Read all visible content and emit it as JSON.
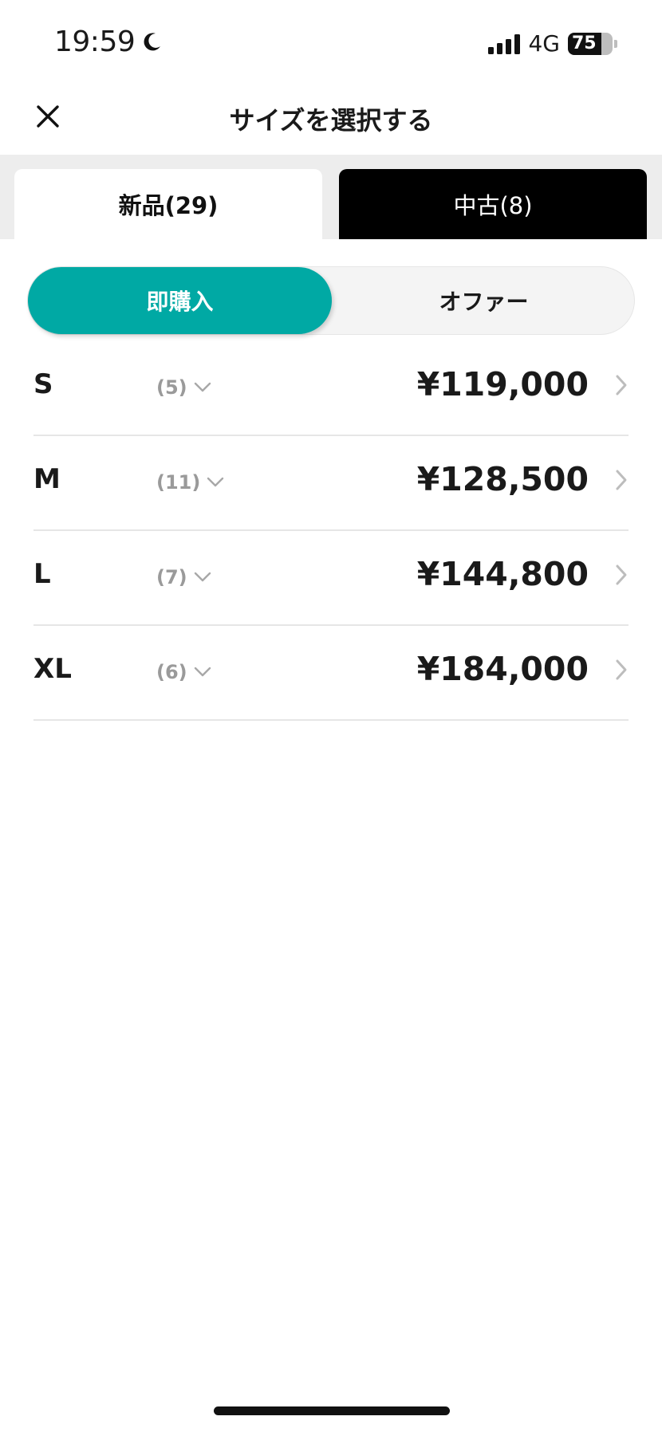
{
  "status_bar": {
    "time": "19:59",
    "network": "4G",
    "battery": "75",
    "battery_level_percent": 75
  },
  "header": {
    "title": "サイズを選択する",
    "close_icon": "close-icon"
  },
  "tabs": [
    {
      "label": "新品(29)",
      "selected": true
    },
    {
      "label": "中古(8)",
      "selected": false
    }
  ],
  "segment": {
    "instant_label": "即購入",
    "offer_label": "オファー",
    "selected": "instant"
  },
  "sizes": [
    {
      "size": "S",
      "count": "(5)",
      "price": "¥119,000"
    },
    {
      "size": "M",
      "count": "(11)",
      "price": "¥128,500"
    },
    {
      "size": "L",
      "count": "(7)",
      "price": "¥144,800"
    },
    {
      "size": "XL",
      "count": "(6)",
      "price": "¥184,000"
    }
  ],
  "colors": {
    "accent": "#00a9a4",
    "tab_inactive_bg": "#000000",
    "tab_strip_bg": "#ededed",
    "muted_text": "#9a9a9a"
  }
}
